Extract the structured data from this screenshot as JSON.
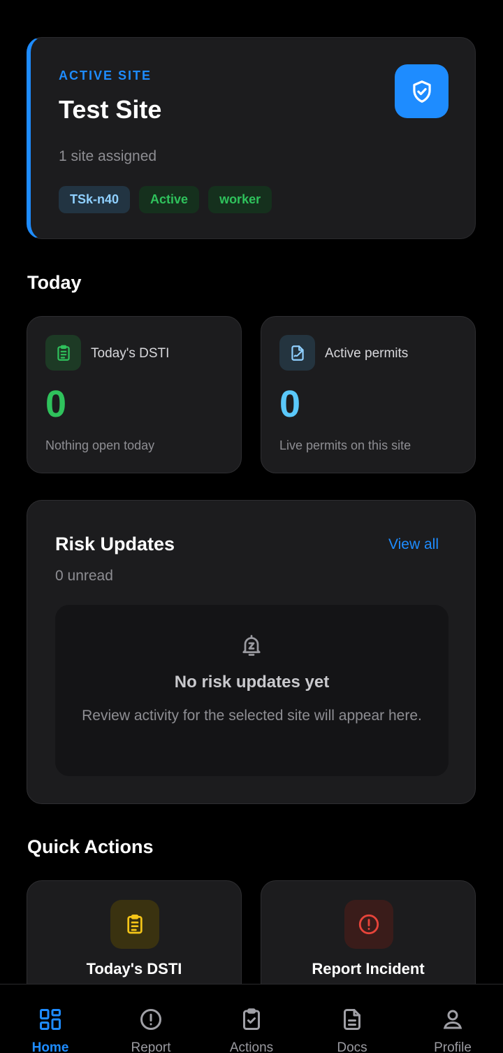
{
  "site": {
    "eyebrow": "ACTIVE SITE",
    "title": "Test Site",
    "subtitle": "1 site assigned",
    "chips": [
      "TSk-n40",
      "Active",
      "worker"
    ],
    "badge_icon": "shield-check-icon"
  },
  "today": {
    "heading": "Today",
    "dsti": {
      "label": "Today's DSTI",
      "value": "0",
      "caption": "Nothing open today",
      "icon": "clipboard-icon",
      "color": "#2fc25c"
    },
    "permits": {
      "label": "Active permits",
      "value": "0",
      "caption": "Live permits on this site",
      "icon": "permit-document-icon",
      "color": "#5ac8fa"
    }
  },
  "risk": {
    "title": "Risk Updates",
    "view_all": "View all",
    "unread": "0 unread",
    "empty_title": "No risk updates yet",
    "empty_text": "Review activity for the selected site will appear here.",
    "empty_icon": "bell-snooze-icon"
  },
  "quick_actions": {
    "heading": "Quick Actions",
    "items": [
      {
        "label": "Today's DSTI",
        "icon": "clipboard-icon",
        "color": "#f5c518"
      },
      {
        "label": "Report Incident",
        "icon": "alert-circle-icon",
        "color": "#e8443a"
      }
    ]
  },
  "nav": {
    "items": [
      {
        "label": "Home",
        "icon": "grid-icon",
        "active": true
      },
      {
        "label": "Report",
        "icon": "alert-circle-icon",
        "active": false
      },
      {
        "label": "Actions",
        "icon": "clipboard-check-icon",
        "active": false
      },
      {
        "label": "Docs",
        "icon": "document-icon",
        "active": false
      },
      {
        "label": "Profile",
        "icon": "person-icon",
        "active": false
      }
    ]
  },
  "colors": {
    "accent": "#1e8cff",
    "card": "#1c1c1e",
    "background": "#000000"
  }
}
